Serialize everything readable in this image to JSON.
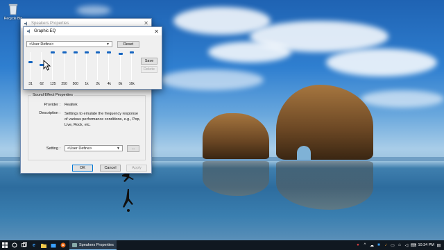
{
  "desktop": {
    "icons": [
      {
        "label": "Recycle Bin",
        "icon": "recycle-bin-icon"
      }
    ]
  },
  "speakers_properties": {
    "title": "Speakers Properties",
    "group_title": "Sound Effect Properties",
    "provider_label": "Provider :",
    "provider_value": "Realtek",
    "description_label": "Description :",
    "description_value": "Settings to emulate the frequency response of various performance conditions, e.g., Pop, Live, Rock, etc.",
    "setting_label": "Setting :",
    "setting_value": "<User Define>",
    "more_button": "...",
    "ok_button": "OK",
    "cancel_button": "Cancel",
    "apply_button": "Apply"
  },
  "graphic_eq": {
    "title": "Graphic EQ",
    "preset_value": "<User Define>",
    "reset_button": "Reset",
    "save_button": "Save",
    "delete_button": "Delete",
    "bands": [
      {
        "freq": "31",
        "level": 0.65
      },
      {
        "freq": "62",
        "level": 0.55
      },
      {
        "freq": "125",
        "level": 1.0
      },
      {
        "freq": "250",
        "level": 1.0
      },
      {
        "freq": "500",
        "level": 1.0
      },
      {
        "freq": "1k",
        "level": 1.0
      },
      {
        "freq": "2k",
        "level": 1.0
      },
      {
        "freq": "4k",
        "level": 1.0
      },
      {
        "freq": "8k",
        "level": 0.95
      },
      {
        "freq": "16k",
        "level": 1.0
      }
    ]
  },
  "taskbar": {
    "app_label": "Speakers Properties",
    "clock": "10:34 PM",
    "pinned_icons": [
      "windows-start-icon",
      "search-icon",
      "task-view-icon",
      "edge-icon",
      "file-explorer-icon",
      "store-icon",
      "media-player-icon"
    ]
  },
  "colors": {
    "accent": "#0078d7",
    "taskbar": "#101820",
    "slider_thumb": "#1565c0"
  }
}
